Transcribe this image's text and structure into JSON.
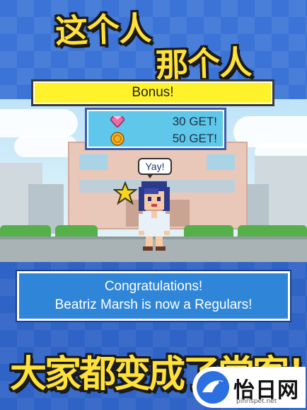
{
  "headlines": {
    "line1": "这个人",
    "line2": "那个人",
    "bottom": "大家都变成了常客！？"
  },
  "bonus": {
    "title": "Bonus!",
    "rewards": [
      {
        "icon": "pink-diamond-icon",
        "text": "30 GET!"
      },
      {
        "icon": "gold-coin-icon",
        "text": "50 GET!"
      }
    ]
  },
  "speech": "Yay!",
  "message": {
    "line1": "Congratulations!",
    "line2": "Beatriz Marsh is now a Regulars!"
  },
  "watermark": {
    "name": "怡日网",
    "url": "pinrispet.net"
  },
  "colors": {
    "background": "#3b74d6",
    "bonus_bar": "#fff22a",
    "reward_box": "#5fc8ea",
    "dialog": "#2f86d8",
    "headline": "#ffe13a"
  }
}
